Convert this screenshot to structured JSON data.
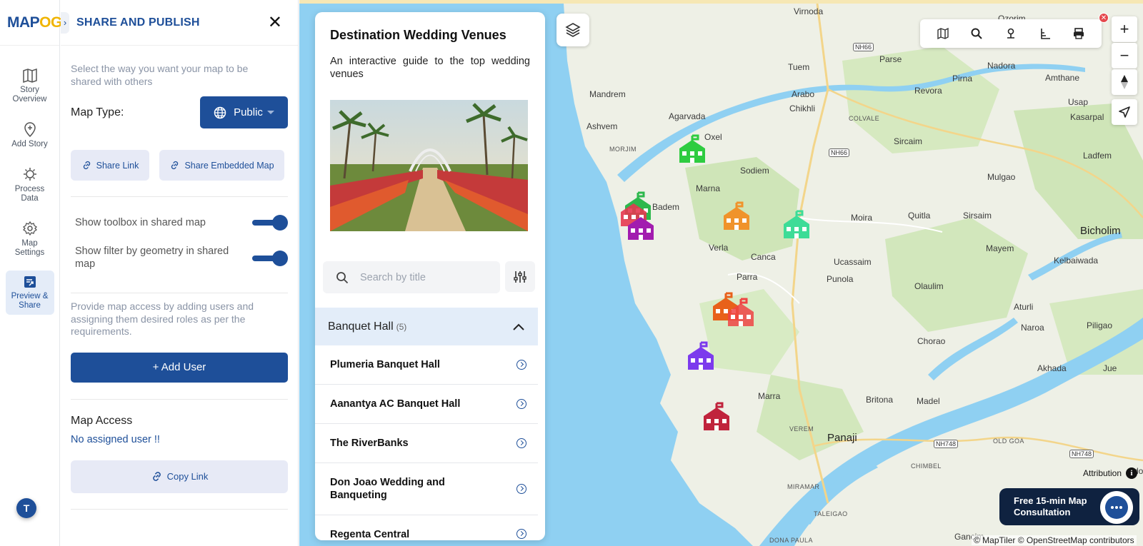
{
  "rail": {
    "logo_a": "MAP",
    "logo_b": "OG",
    "items": [
      {
        "label": "Story Overview",
        "icon": "map-icon"
      },
      {
        "label": "Add Story",
        "icon": "pin-plus-icon"
      },
      {
        "label": "Process Data",
        "icon": "process-icon"
      },
      {
        "label": "Map Settings",
        "icon": "gear-icon"
      },
      {
        "label": "Preview & Share",
        "icon": "share-icon"
      }
    ],
    "avatar_initial": "T"
  },
  "panel": {
    "title": "SHARE AND PUBLISH",
    "share_hint": "Select the way you want your map to be shared with others",
    "map_type_label": "Map Type:",
    "map_type_value": "Public",
    "share_link": "Share Link",
    "share_embedded": "Share Embedded Map",
    "toggle_toolbox": "Show toolbox in shared map",
    "toggle_filter": "Show filter by geometry in shared map",
    "toolbox_on": true,
    "filter_on": true,
    "access_hint": "Provide map access by adding users and assigning them desired roles as per the requirements.",
    "add_user": "+ Add User",
    "map_access_title": "Map Access",
    "no_user": "No assigned user !!",
    "copy_link": "Copy Link"
  },
  "story": {
    "title": "Destination Wedding Venues",
    "description": "An interactive guide to the top wedding venues",
    "search_placeholder": "Search by title",
    "group_name": "Banquet Hall",
    "group_count": "(5)",
    "venues": [
      "Plumeria Banquet Hall",
      "Aanantya AC Banquet Hall",
      "The RiverBanks",
      "Don Joao Wedding and Banqueting",
      "Regenta Central"
    ]
  },
  "map": {
    "labels": [
      "Virnoda",
      "Ozorim",
      "Parse",
      "Tuem",
      "Nadora",
      "Pirna",
      "Amthane",
      "Mandrem",
      "Arabo",
      "Revora",
      "Usap",
      "Kasarpal",
      "Chikhli",
      "COLVALE",
      "Agarvada",
      "Ashvem",
      "Oxel",
      "Sircaim",
      "Ladfem",
      "MORJIM",
      "Sodiem",
      "Mulgao",
      "Badem",
      "Marna",
      "Moira",
      "Quitla",
      "Sirsaim",
      "Bicholim",
      "Verla",
      "Canca",
      "Ucassaim",
      "Mayem",
      "Kelbaiwada",
      "Parra",
      "Punola",
      "Olaulim",
      "Aturli",
      "Naroa",
      "Piligao",
      "Chorao",
      "Akhada",
      "Jue",
      "Britona",
      "Madel",
      "Marra",
      "Panaji",
      "VEREM",
      "OLD GOA",
      "CHIMBEL",
      "MIRAMAR",
      "TALEIGAO",
      "DONA PAULA",
      "Gancim",
      "Ado"
    ],
    "roads": [
      "NH66",
      "NH66",
      "NH748",
      "NH748"
    ],
    "toolbar_icons": [
      "map-icon",
      "search-icon",
      "location-icon",
      "measure-icon",
      "print-icon"
    ],
    "zoom_in": "+",
    "zoom_out": "−",
    "attribution": "Attribution",
    "copyright": "© MapTiler © OpenStreetMap contributors",
    "consult": "Free 15-min Map Consultation",
    "marker_colors": [
      "#2ecc40",
      "#2db84d",
      "#e63950",
      "#a21caf",
      "#f0932b",
      "#3ddc97",
      "#e8611a",
      "#ef4444",
      "#7c3aed",
      "#c0233c"
    ]
  }
}
